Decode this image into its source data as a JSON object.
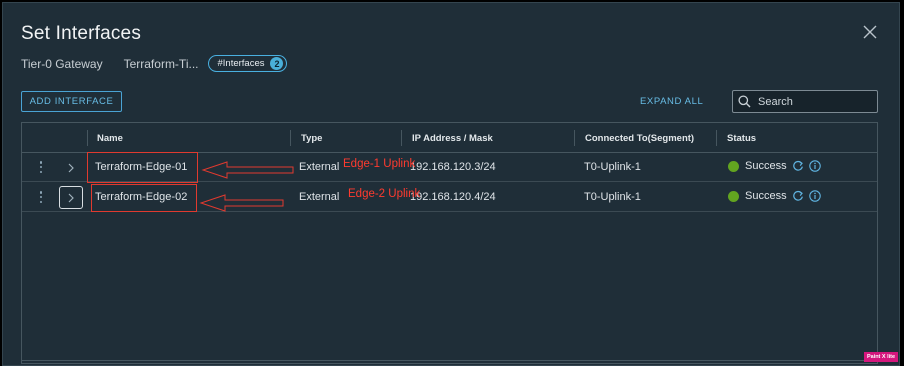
{
  "dialog": {
    "title": "Set Interfaces",
    "gateway_label": "Tier-0 Gateway",
    "gateway_name": "Terraform-Ti...",
    "pill_label": "#Interfaces",
    "pill_count": "2"
  },
  "toolbar": {
    "add_label": "ADD INTERFACE",
    "expand_label": "EXPAND ALL",
    "search_placeholder": "Search"
  },
  "table": {
    "columns": [
      "Name",
      "Type",
      "IP Address / Mask",
      "Connected To(Segment)",
      "Status"
    ],
    "rows": [
      {
        "name": "Terraform-Edge-01",
        "type": "External",
        "ip": "192.168.120.3/24",
        "segment": "T0-Uplink-1",
        "status": "Success"
      },
      {
        "name": "Terraform-Edge-02",
        "type": "External",
        "ip": "192.168.120.4/24",
        "segment": "T0-Uplink-1",
        "status": "Success"
      }
    ]
  },
  "annotations": {
    "row1": "Edge-1 Uplink",
    "row2": "Edge-2 Uplink"
  },
  "watermark": "Paint X lite",
  "colors": {
    "background": "#1f2e38",
    "accent": "#49afd9",
    "success": "#62a420",
    "annotation": "#e03a2f"
  },
  "icons": [
    "close-icon",
    "search-icon",
    "kebab-menu-icon",
    "chevron-right-icon",
    "refresh-icon",
    "info-icon",
    "status-dot-icon"
  ]
}
